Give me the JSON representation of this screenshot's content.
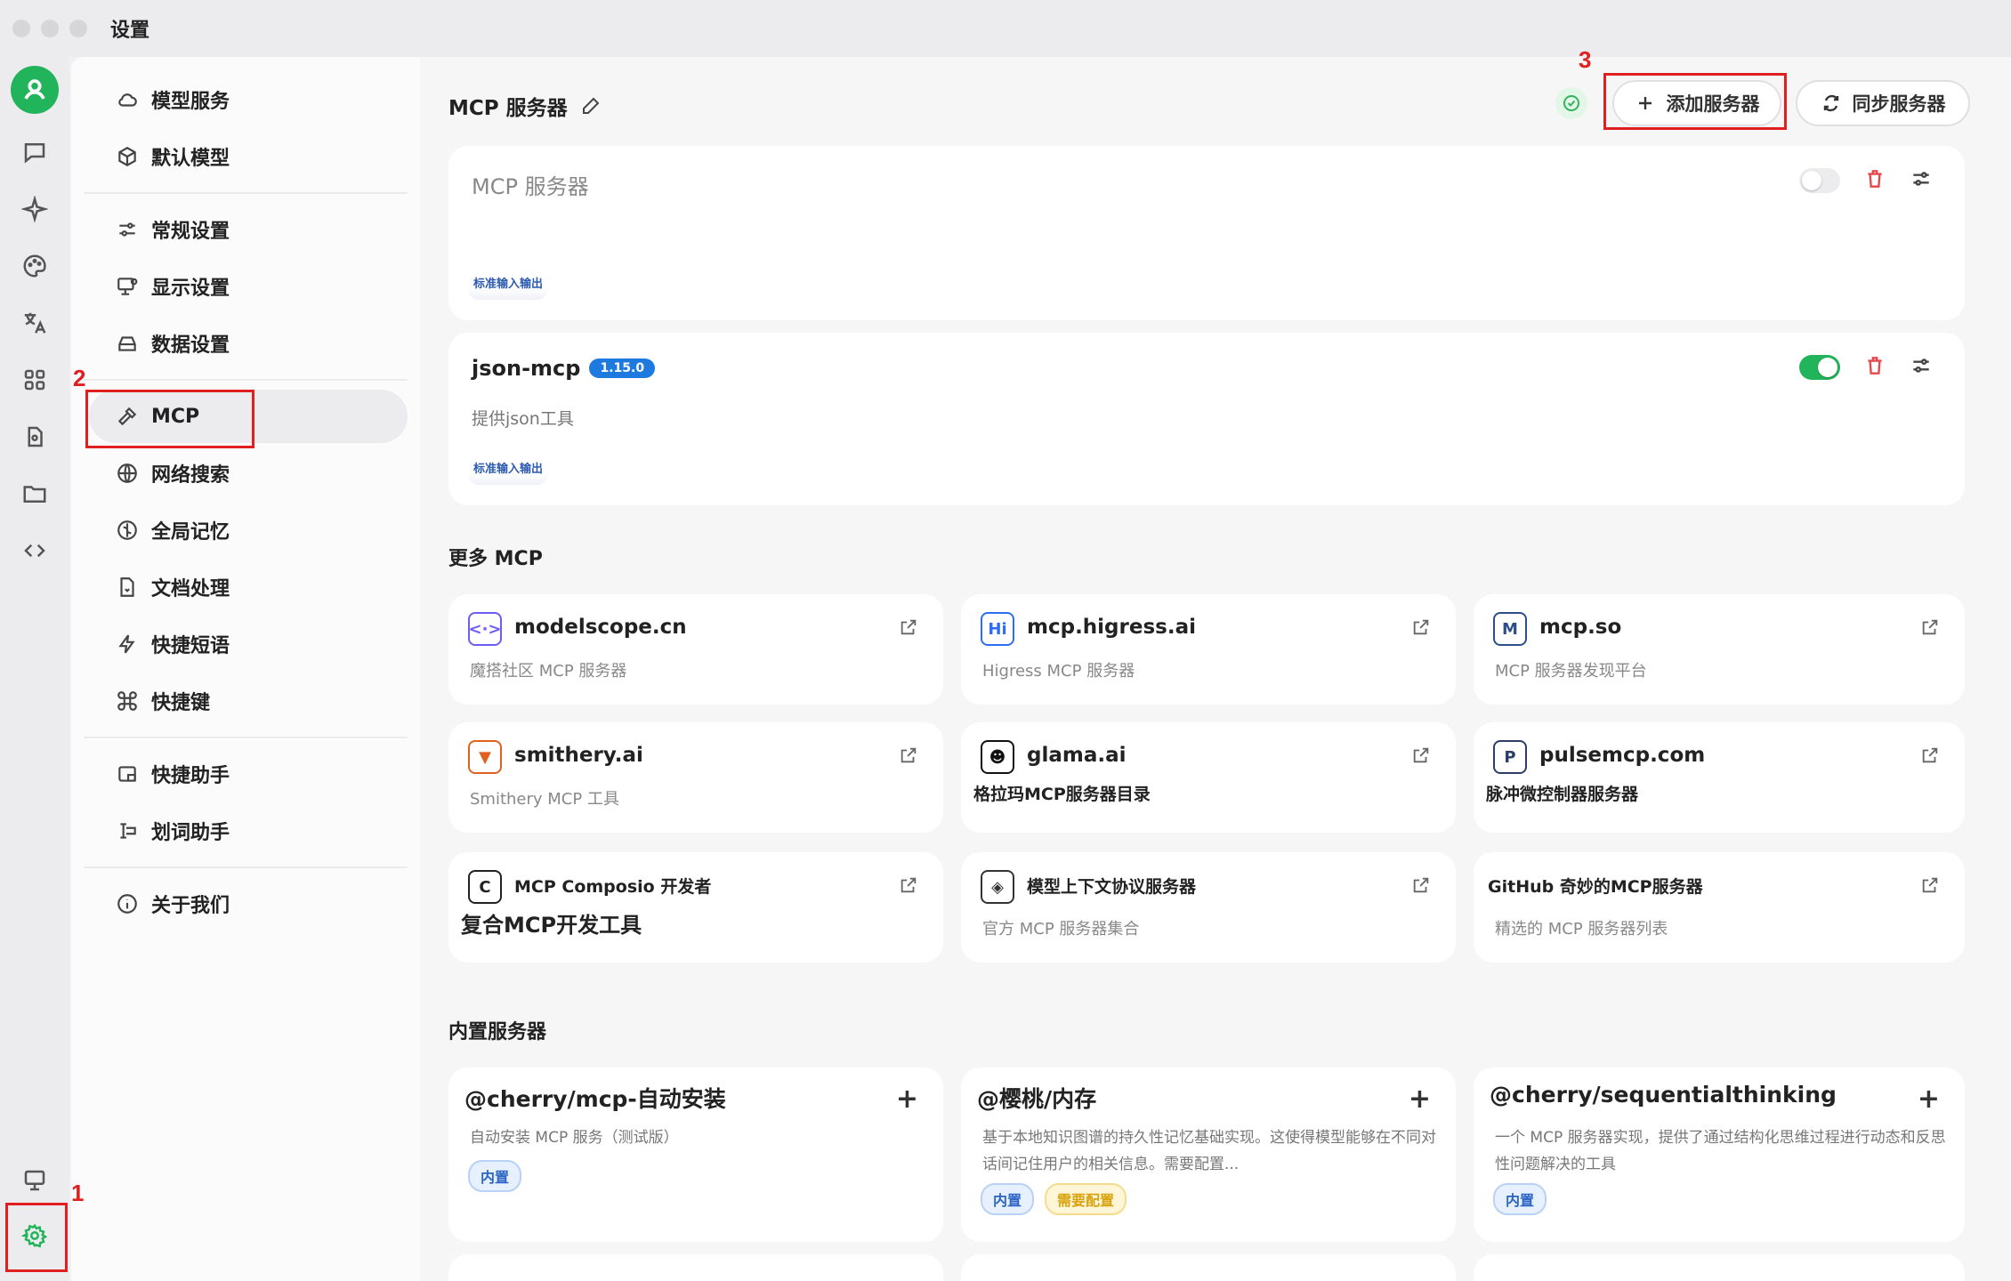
{
  "window": {
    "title": "设置"
  },
  "rail": {
    "items": [
      "avatar-icon",
      "chat-icon",
      "sparkle-icon",
      "palette-icon",
      "translate-icon",
      "apps-icon",
      "files-icon",
      "folder-icon",
      "code-icon",
      "monitor-icon",
      "settings-gear-icon"
    ]
  },
  "nav": {
    "items": [
      {
        "label": "模型服务",
        "icon": "cloud-icon"
      },
      {
        "label": "默认模型",
        "icon": "cube-icon"
      },
      {
        "label": "常规设置",
        "icon": "sliders-icon"
      },
      {
        "label": "显示设置",
        "icon": "display-icon"
      },
      {
        "label": "数据设置",
        "icon": "drive-icon"
      },
      {
        "label": "MCP",
        "icon": "hammer-icon"
      },
      {
        "label": "网络搜索",
        "icon": "globe-icon"
      },
      {
        "label": "全局记忆",
        "icon": "memory-icon"
      },
      {
        "label": "文档处理",
        "icon": "document-icon"
      },
      {
        "label": "快捷短语",
        "icon": "bolt-icon"
      },
      {
        "label": "快捷键",
        "icon": "command-icon"
      },
      {
        "label": "快捷助手",
        "icon": "assistant-icon"
      },
      {
        "label": "划词助手",
        "icon": "select-text-icon"
      },
      {
        "label": "关于我们",
        "icon": "info-icon"
      }
    ]
  },
  "header": {
    "title": "MCP 服务器",
    "add_label": "添加服务器",
    "sync_label": "同步服务器"
  },
  "servers": [
    {
      "name": "MCP 服务器",
      "version": "",
      "description": "",
      "transport": "标准输入输出",
      "enabled": false
    },
    {
      "name": "json-mcp",
      "version": "1.15.0",
      "description": "提供json工具",
      "transport": "标准输入输出",
      "enabled": true
    }
  ],
  "more_mcp": {
    "title": "更多 MCP",
    "links": [
      {
        "name": "modelscope.cn",
        "description": "魔搭社区 MCP 服务器",
        "logo": "modelscope-logo",
        "logo_text": "<·>",
        "logo_color": "#6b5cf5"
      },
      {
        "name": "mcp.higress.ai",
        "description": "Higress MCP 服务器",
        "logo": "higress-logo",
        "logo_text": "Hi",
        "logo_color": "#2d6df6"
      },
      {
        "name": "mcp.so",
        "description": "MCP 服务器发现平台",
        "logo": "mcpso-logo",
        "logo_text": "M",
        "logo_color": "#2c4f8a"
      },
      {
        "name": "smithery.ai",
        "description": "Smithery MCP 工具",
        "logo": "smithery-logo",
        "logo_text": "▼",
        "logo_color": "#e0601f"
      },
      {
        "name": "glama.ai",
        "description": "格拉玛MCP服务器目录",
        "logo": "glama-logo",
        "logo_text": "☻",
        "logo_color": "#111111"
      },
      {
        "name": "pulsemcp.com",
        "description": "脉冲微控制器服务器",
        "logo": "pulsemcp-logo",
        "logo_text": "P",
        "logo_color": "#2c3e66"
      },
      {
        "name": "MCP Composio 开发者",
        "description": "复合MCP开发工具",
        "logo": "composio-logo",
        "logo_text": "C",
        "logo_color": "#222222"
      },
      {
        "name": "模型上下文协议服务器",
        "description": "官方 MCP 服务器集合",
        "logo": "mcp-protocol-logo",
        "logo_text": "◈",
        "logo_color": "#333333"
      },
      {
        "name": "GitHub 奇妙的MCP服务器",
        "description": "精选的 MCP 服务器列表",
        "logo": "",
        "logo_text": "",
        "logo_color": ""
      }
    ]
  },
  "builtin": {
    "title": "内置服务器",
    "items": [
      {
        "name": "@cherry/mcp-自动安装",
        "description": "自动安装 MCP 服务（测试版）",
        "tags": [
          "内置"
        ]
      },
      {
        "name": "@樱桃/内存",
        "description": "基于本地知识图谱的持久性记忆基础实现。这使得模型能够在不同对话间记住用户的相关信息。需要配置...",
        "tags": [
          "内置",
          "需要配置"
        ]
      },
      {
        "name": "@cherry/sequentialthinking",
        "description": "一个 MCP 服务器实现，提供了通过结构化思维过程进行动态和反思性问题解决的工具",
        "tags": [
          "内置"
        ]
      }
    ]
  },
  "annotations": [
    "1",
    "2",
    "3"
  ],
  "colors": {
    "accent_green": "#22b45a",
    "annotation_red": "#e02020",
    "delete_red": "#e5484d",
    "badge_blue": "#1f7ae0"
  }
}
